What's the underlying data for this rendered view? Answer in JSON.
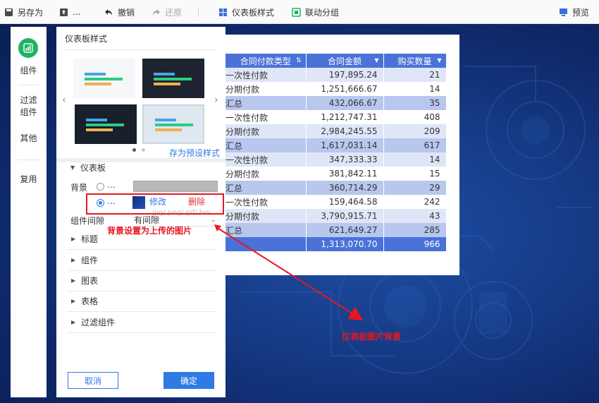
{
  "toolbar": {
    "save_as": "另存为",
    "more": "...",
    "undo": "撤销",
    "redo": "还原",
    "dashboard_style": "仪表板样式",
    "linkage_group": "联动分组",
    "preview": "预览"
  },
  "leftnav": {
    "components": "组件",
    "filter_line1": "过滤",
    "filter_line2": "组件",
    "other": "其他",
    "reuse": "复用"
  },
  "panel": {
    "title": "仪表板样式",
    "save_preset": "存为预设样式",
    "section_dashboard": "仪表板",
    "background_label": "背景",
    "option_ellipsis_1": "...",
    "option_ellipsis_2": "...",
    "modify": "修改",
    "delete": "删除",
    "file_hint": "jpg/.png/.gif/.bm",
    "gap_label": "组件间隙",
    "gap_value": "有间隙",
    "sections": [
      "标题",
      "组件",
      "图表",
      "表格",
      "过滤组件"
    ],
    "cancel": "取消",
    "confirm": "确定"
  },
  "table": {
    "headers": [
      "合同付款类型",
      "合同金额",
      "购买数量"
    ],
    "rows": [
      {
        "type": "一次性付款",
        "amount": "197,895.24",
        "qty": "21",
        "kind": "light"
      },
      {
        "type": "分期付款",
        "amount": "1,251,666.67",
        "qty": "14",
        "kind": "white"
      },
      {
        "type": "汇总",
        "amount": "432,066.67",
        "qty": "35",
        "kind": "sub"
      },
      {
        "type": "一次性付款",
        "amount": "1,212,747.31",
        "qty": "408",
        "kind": "white"
      },
      {
        "type": "分期付款",
        "amount": "2,984,245.55",
        "qty": "209",
        "kind": "light"
      },
      {
        "type": "汇总",
        "amount": "1,617,031.14",
        "qty": "617",
        "kind": "sub"
      },
      {
        "type": "一次性付款",
        "amount": "347,333.33",
        "qty": "14",
        "kind": "light"
      },
      {
        "type": "分期付款",
        "amount": "381,842.11",
        "qty": "15",
        "kind": "white"
      },
      {
        "type": "汇总",
        "amount": "360,714.29",
        "qty": "29",
        "kind": "sub"
      },
      {
        "type": "一次性付款",
        "amount": "159,464.58",
        "qty": "242",
        "kind": "white"
      },
      {
        "type": "分期付款",
        "amount": "3,790,915.71",
        "qty": "43",
        "kind": "light"
      },
      {
        "type": "汇总",
        "amount": "621,649.27",
        "qty": "285",
        "kind": "sub"
      },
      {
        "type": "",
        "amount": "1,313,070.70",
        "qty": "966",
        "kind": "total"
      }
    ]
  },
  "annotations": {
    "callout_upload": "背景设置为上传的图片",
    "callout_background": "仪表板图片背景"
  },
  "colors": {
    "accent": "#2f7ae5",
    "header_blue": "#4a72d8",
    "annotation_red": "#e8161e",
    "nav_green": "#1eb363"
  }
}
